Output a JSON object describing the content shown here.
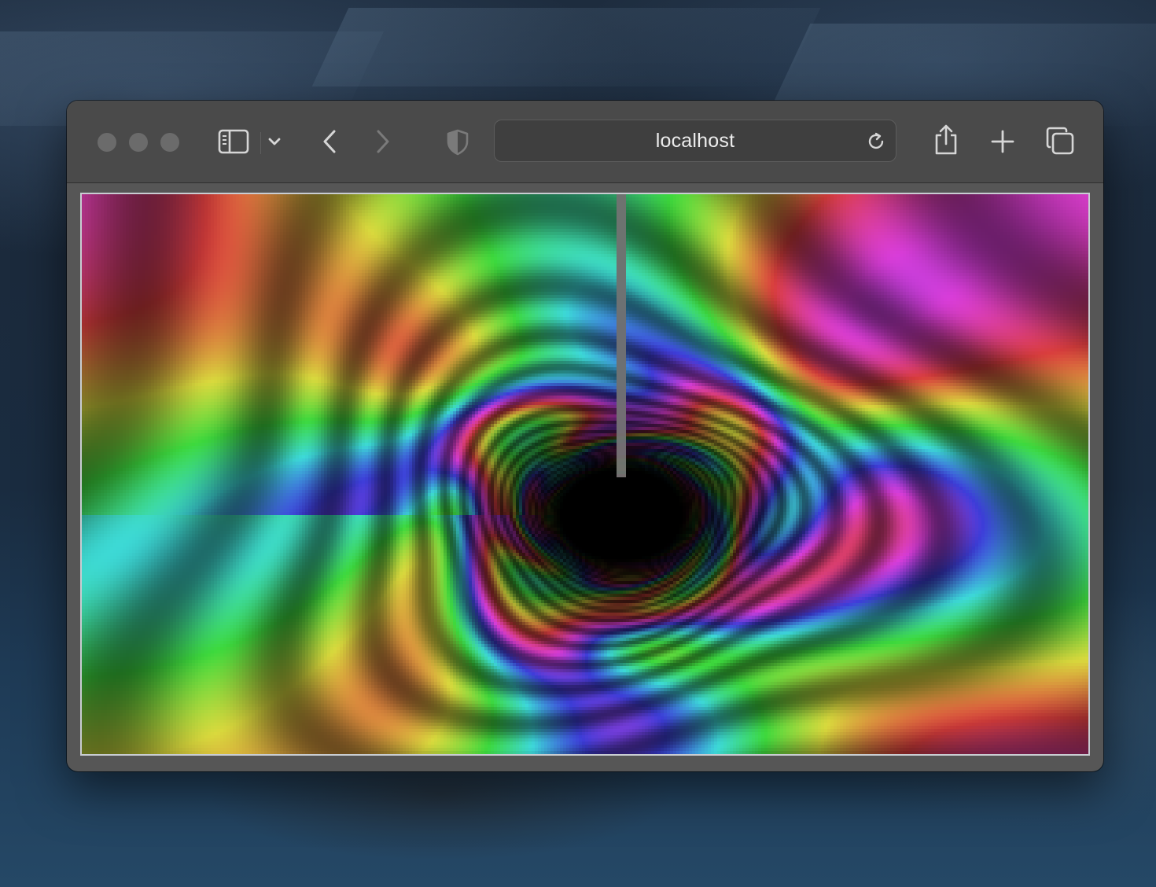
{
  "browser": {
    "address_bar": {
      "url": "localhost"
    },
    "toolbar": {
      "icons": [
        "sidebar-icon",
        "chevron-down-icon",
        "back-icon",
        "forward-icon",
        "privacy-shield-icon",
        "reload-icon",
        "share-icon",
        "new-tab-icon",
        "tab-overview-icon"
      ]
    }
  },
  "page": {
    "content": "pixelated-psychedelic-tunnel-canvas"
  },
  "colors": {
    "toolbar_bg": "#4a4a4a",
    "window_bg": "#565656",
    "address_bg": "#3f3f3f",
    "icon_color": "#d6d6d6",
    "icon_disabled": "#7a7a7a"
  }
}
